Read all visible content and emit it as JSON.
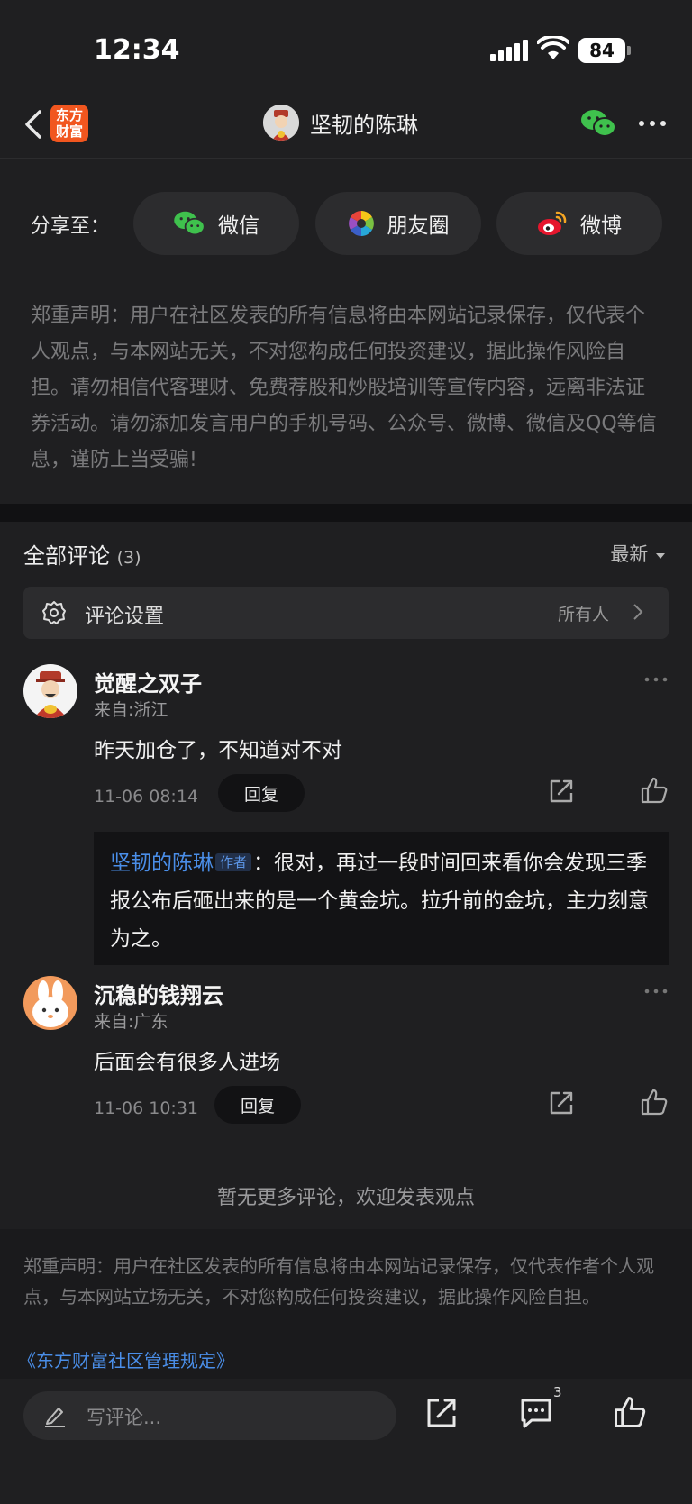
{
  "status_bar": {
    "time": "12:34",
    "battery": "84"
  },
  "nav": {
    "logo_line1": "东方",
    "logo_line2": "财富",
    "title": "坚韧的陈琳"
  },
  "share": {
    "label": "分享至：",
    "wechat": "微信",
    "moments": "朋友圈",
    "weibo": "微博"
  },
  "disclaimer_top": "郑重声明：用户在社区发表的所有信息将由本网站记录保存，仅代表个人观点，与本网站无关，不对您构成任何投资建议，据此操作风险自担。请勿相信代客理财、免费荐股和炒股培训等宣传内容，远离非法证券活动。请勿添加发言用户的手机号码、公众号、微博、微信及QQ等信息，谨防上当受骗!",
  "comments": {
    "header": "全部评论",
    "count": "(3)",
    "sort": "最新",
    "settings_label": "评论设置",
    "settings_value": "所有人",
    "items": [
      {
        "name": "觉醒之双子",
        "location": "来自:浙江",
        "text": "昨天加仓了，不知道对不对",
        "time": "11-06 08:14",
        "reply": "回复",
        "sub_reply": {
          "name": "坚韧的陈琳",
          "tag": "作者",
          "text": "：很对，再过一段时间回来看你会发现三季报公布后砸出来的是一个黄金坑。拉升前的金坑，主力刻意为之。"
        }
      },
      {
        "name": "沉稳的钱翔云",
        "location": "来自:广东",
        "text": "后面会有很多人进场",
        "time": "11-06 10:31",
        "reply": "回复"
      }
    ],
    "no_more": "暂无更多评论，欢迎发表观点"
  },
  "footer": {
    "disclaimer": "郑重声明：用户在社区发表的所有信息将由本网站记录保存，仅代表作者个人观点，与本网站立场无关，不对您构成任何投资建议，据此操作风险自担。",
    "link": "《东方财富社区管理规定》"
  },
  "bottom_bar": {
    "input_placeholder": "写评论...",
    "comment_badge": "3"
  },
  "colors": {
    "background": "#1f1f21",
    "link": "#4a8ee8",
    "wechat_green": "#3fc14d",
    "logo_orange": "#f1561f"
  }
}
